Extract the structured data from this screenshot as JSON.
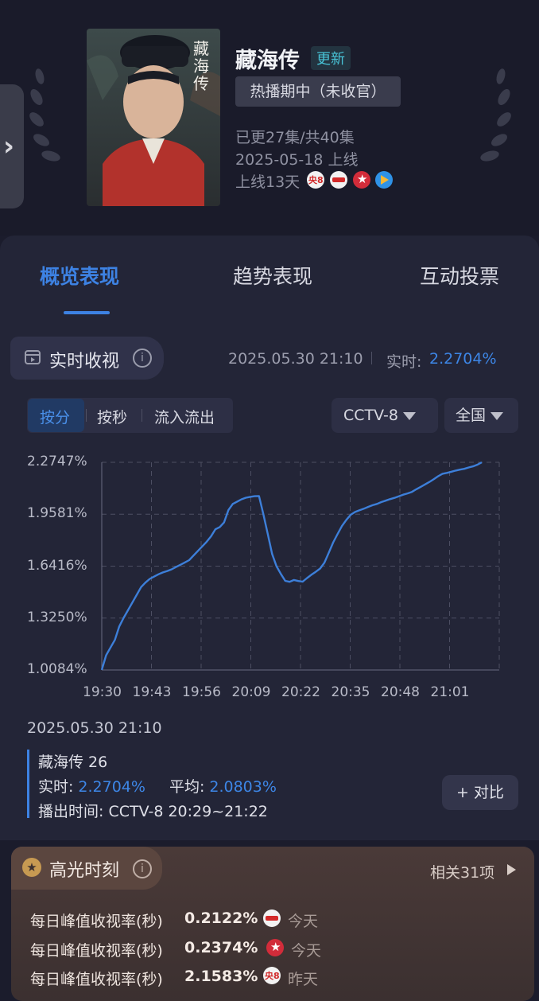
{
  "header": {
    "title": "藏海传",
    "update_badge": "更新",
    "status": "热播期中（未收官）",
    "episodes": "已更27集/共40集",
    "release": "2025-05-18 上线",
    "days_online": "上线13天",
    "poster_text": "藏海传",
    "channels": [
      "cctv8-icon",
      "youku-icon",
      "dragon-tv-icon",
      "tencent-video-icon"
    ]
  },
  "tabs": [
    {
      "label": "概览表现",
      "active": true
    },
    {
      "label": "趋势表现",
      "active": false
    },
    {
      "label": "互动投票",
      "active": false
    }
  ],
  "realtime": {
    "label": "实时收视",
    "timestamp": "2025.05.30 21:10",
    "rt_label": "实时:",
    "rt_value": "2.2704%"
  },
  "segments": [
    "按分",
    "按秒",
    "流入流出"
  ],
  "filters": {
    "channel": "CCTV-8",
    "region": "全国"
  },
  "chart_data": {
    "type": "line",
    "y_ticks": [
      "2.2747%",
      "1.9581%",
      "1.6416%",
      "1.3250%",
      "1.0084%"
    ],
    "x_ticks": [
      "19:30",
      "19:43",
      "19:56",
      "20:09",
      "20:22",
      "20:35",
      "20:48",
      "21:01"
    ],
    "ylim": [
      1.0084,
      2.2747
    ],
    "x_minutes": [
      0,
      1,
      2,
      3,
      4,
      5,
      6,
      7,
      8,
      9,
      10,
      11,
      12,
      13,
      14,
      15,
      16,
      17,
      18,
      19,
      20,
      21,
      22,
      23,
      24,
      25,
      26,
      27,
      28,
      29,
      30,
      31,
      32,
      33,
      34,
      35,
      36,
      37,
      38,
      39,
      40,
      41,
      42,
      43,
      44,
      45,
      46,
      47,
      48,
      49,
      50,
      51,
      52,
      53,
      54,
      55,
      56,
      57,
      58,
      59,
      60,
      61,
      62,
      63,
      64,
      65,
      66,
      67,
      68,
      69,
      70,
      71,
      72,
      73,
      74,
      75,
      76,
      77,
      78,
      79,
      80,
      81,
      82,
      83,
      84,
      85,
      86,
      87,
      88,
      89,
      90,
      91,
      92,
      93,
      94,
      95,
      96,
      97,
      98,
      99,
      100
    ],
    "values": [
      1.009,
      1.098,
      1.145,
      1.192,
      1.274,
      1.326,
      1.373,
      1.42,
      1.467,
      1.514,
      1.541,
      1.564,
      1.578,
      1.592,
      1.603,
      1.612,
      1.622,
      1.636,
      1.65,
      1.664,
      1.678,
      1.706,
      1.734,
      1.762,
      1.79,
      1.823,
      1.866,
      1.88,
      1.908,
      1.983,
      2.021,
      2.035,
      2.049,
      2.059,
      2.064,
      2.068,
      2.069,
      1.958,
      1.838,
      1.716,
      1.641,
      1.594,
      1.552,
      1.546,
      1.557,
      1.551,
      1.547,
      1.569,
      1.589,
      1.607,
      1.627,
      1.664,
      1.725,
      1.787,
      1.838,
      1.887,
      1.924,
      1.955,
      1.972,
      1.982,
      1.992,
      2.003,
      2.013,
      2.021,
      2.032,
      2.041,
      2.05,
      2.058,
      2.067,
      2.077,
      2.085,
      2.094,
      2.11,
      2.125,
      2.14,
      2.155,
      2.172,
      2.19,
      2.205,
      2.21,
      2.217,
      2.224,
      2.23,
      2.235,
      2.243,
      2.25,
      2.26,
      2.274
    ]
  },
  "detail": {
    "date": "2025.05.30 21:10",
    "episode": "藏海传 26",
    "rt_label": "实时:",
    "rt_value": "2.2704%",
    "avg_label": "平均:",
    "avg_value": "2.0803%",
    "airtime": "播出时间:  CCTV-8 20:29~21:22",
    "compare": "+ 对比"
  },
  "highlights": {
    "title": "高光时刻",
    "more": "相关31项",
    "rows": [
      {
        "label": "每日峰值收视率(秒)",
        "value": "0.2122%",
        "channel_icon": "youku-icon",
        "day": "今天"
      },
      {
        "label": "每日峰值收视率(秒)",
        "value": "0.2374%",
        "channel_icon": "dragon-tv-icon",
        "day": "今天"
      },
      {
        "label": "每日峰值收视率(秒)",
        "value": "2.1583%",
        "channel_icon": "cctv8-icon",
        "day": "昨天"
      }
    ]
  }
}
